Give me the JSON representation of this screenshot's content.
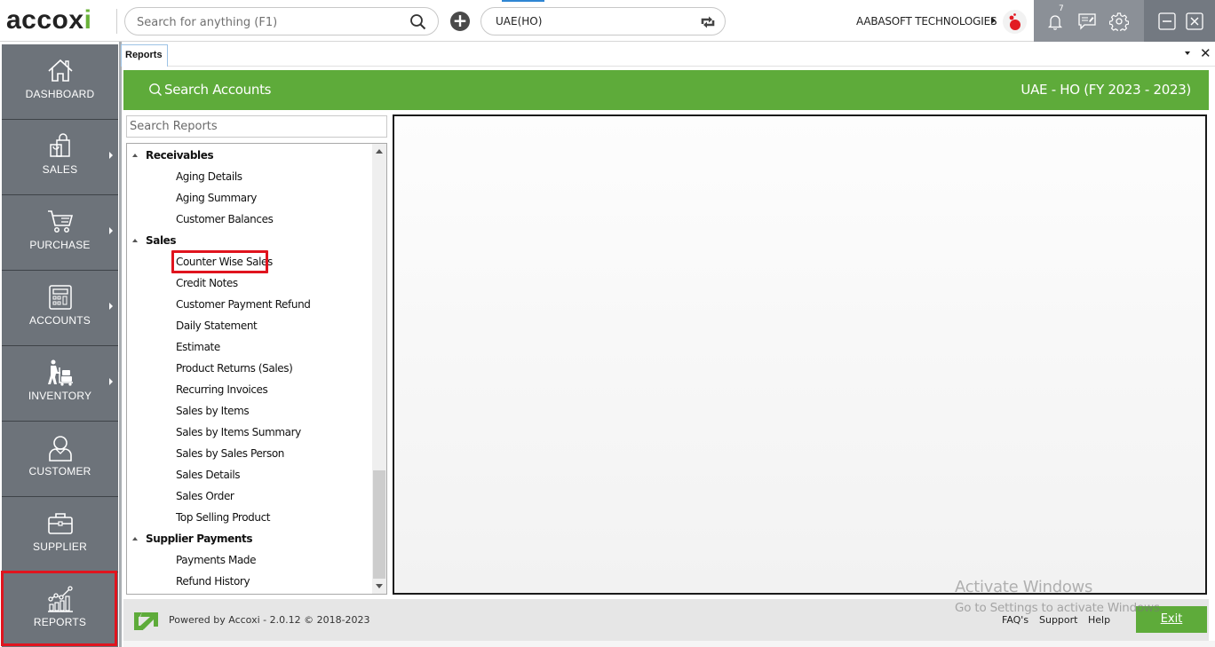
{
  "app": {
    "logo_text": "accoxi",
    "global_search": {
      "placeholder": "Search for anything (F1)",
      "value": ""
    },
    "branch": "UAE(HO)",
    "company": "AABASOFT TECHNOLOGIES",
    "notification_count": "7",
    "icons": {
      "search": "search-icon",
      "add": "plus-circle-icon",
      "refresh": "refresh-icon",
      "notifications": "bell-icon",
      "messages": "chat-edit-icon",
      "settings": "gear-icon",
      "minimize": "minimize-icon",
      "close": "close-icon"
    }
  },
  "sidebar": {
    "items": [
      {
        "label": "DASHBOARD",
        "icon": "home-icon",
        "has_submenu": false
      },
      {
        "label": "SALES",
        "icon": "shopping-bags-icon",
        "has_submenu": true
      },
      {
        "label": "PURCHASE",
        "icon": "cart-icon",
        "has_submenu": true
      },
      {
        "label": "ACCOUNTS",
        "icon": "calculator-icon",
        "has_submenu": true
      },
      {
        "label": "INVENTORY",
        "icon": "worker-trolley-icon",
        "has_submenu": true
      },
      {
        "label": "CUSTOMER",
        "icon": "user-icon",
        "has_submenu": false
      },
      {
        "label": "SUPPLIER",
        "icon": "briefcase-icon",
        "has_submenu": false
      },
      {
        "label": "REPORTS",
        "icon": "chart-icon",
        "has_submenu": false,
        "highlighted": true
      }
    ]
  },
  "tabs": [
    {
      "label": "Reports",
      "active": true
    }
  ],
  "header": {
    "search_accounts_label": "Search Accounts",
    "fy_label": "UAE - HO (FY 2023 - 2023)"
  },
  "reports": {
    "search": {
      "placeholder": "Search Reports",
      "value": ""
    },
    "tree": [
      {
        "type": "group",
        "label": "Receivables",
        "expanded": true
      },
      {
        "type": "item",
        "label": "Aging Details"
      },
      {
        "type": "item",
        "label": "Aging Summary"
      },
      {
        "type": "item",
        "label": "Customer Balances"
      },
      {
        "type": "group",
        "label": "Sales",
        "expanded": true
      },
      {
        "type": "item",
        "label": "Counter Wise Sales",
        "highlighted": true
      },
      {
        "type": "item",
        "label": "Credit Notes"
      },
      {
        "type": "item",
        "label": "Customer Payment Refund"
      },
      {
        "type": "item",
        "label": "Daily Statement"
      },
      {
        "type": "item",
        "label": "Estimate"
      },
      {
        "type": "item",
        "label": "Product Returns (Sales)"
      },
      {
        "type": "item",
        "label": "Recurring Invoices"
      },
      {
        "type": "item",
        "label": "Sales by Items"
      },
      {
        "type": "item",
        "label": "Sales by Items Summary"
      },
      {
        "type": "item",
        "label": "Sales by Sales Person"
      },
      {
        "type": "item",
        "label": "Sales Details"
      },
      {
        "type": "item",
        "label": "Sales Order"
      },
      {
        "type": "item",
        "label": "Top Selling Product"
      },
      {
        "type": "group",
        "label": "Supplier Payments",
        "expanded": true
      },
      {
        "type": "item",
        "label": "Payments Made"
      },
      {
        "type": "item",
        "label": "Refund History"
      }
    ]
  },
  "footer": {
    "powered_by": "Powered by Accoxi - 2.0.12 © 2018-2023",
    "links": [
      "FAQ's",
      "Support",
      "Help"
    ],
    "exit_label": "Exit"
  },
  "watermark": {
    "line1": "Activate Windows",
    "line2": "Go to Settings to activate Windows."
  },
  "colors": {
    "brand_green": "#5eab3a",
    "sidebar_bg": "#6d737a",
    "highlight_red": "#e0141e"
  }
}
